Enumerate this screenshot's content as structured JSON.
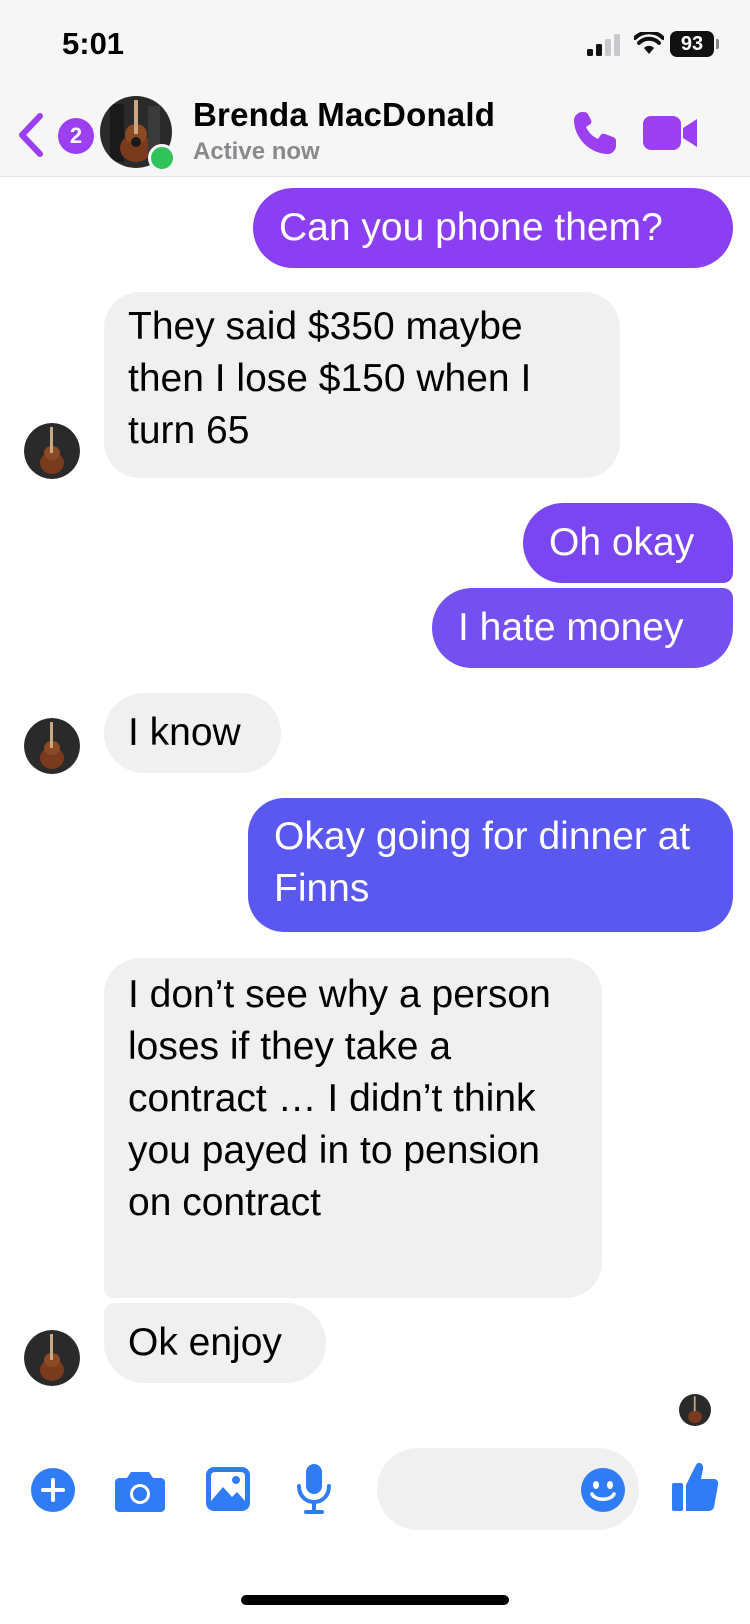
{
  "status_bar": {
    "time": "5:01",
    "battery": "93"
  },
  "header": {
    "back_badge": "2",
    "contact_name": "Brenda MacDonald",
    "status": "Active now"
  },
  "messages": [
    {
      "side": "out",
      "text": "Can you phone them?"
    },
    {
      "side": "in",
      "text": "They said $350 maybe then I lose $150 when I turn 65"
    },
    {
      "side": "out",
      "text": "Oh okay"
    },
    {
      "side": "out",
      "text": "I hate money"
    },
    {
      "side": "in",
      "text": "I know"
    },
    {
      "side": "out",
      "text": "Okay going for dinner at Finns"
    },
    {
      "side": "in",
      "text": "I don’t see why a person loses if they take a contract … I didn’t think you payed in to pension on contract"
    },
    {
      "side": "in",
      "text": "Ok enjoy"
    }
  ],
  "composer": {
    "input_value": "",
    "icons": [
      "plus-icon",
      "camera-icon",
      "gallery-icon",
      "microphone-icon",
      "emoji-icon",
      "thumbs-up-icon"
    ]
  },
  "colors": {
    "accent": "#9b3ff0",
    "outgoing_top": "#8a3ff2",
    "outgoing_bottom": "#4f5df0",
    "incoming": "#f0f0f0",
    "composer_icon": "#2f7cf6",
    "online": "#2fc35a"
  }
}
